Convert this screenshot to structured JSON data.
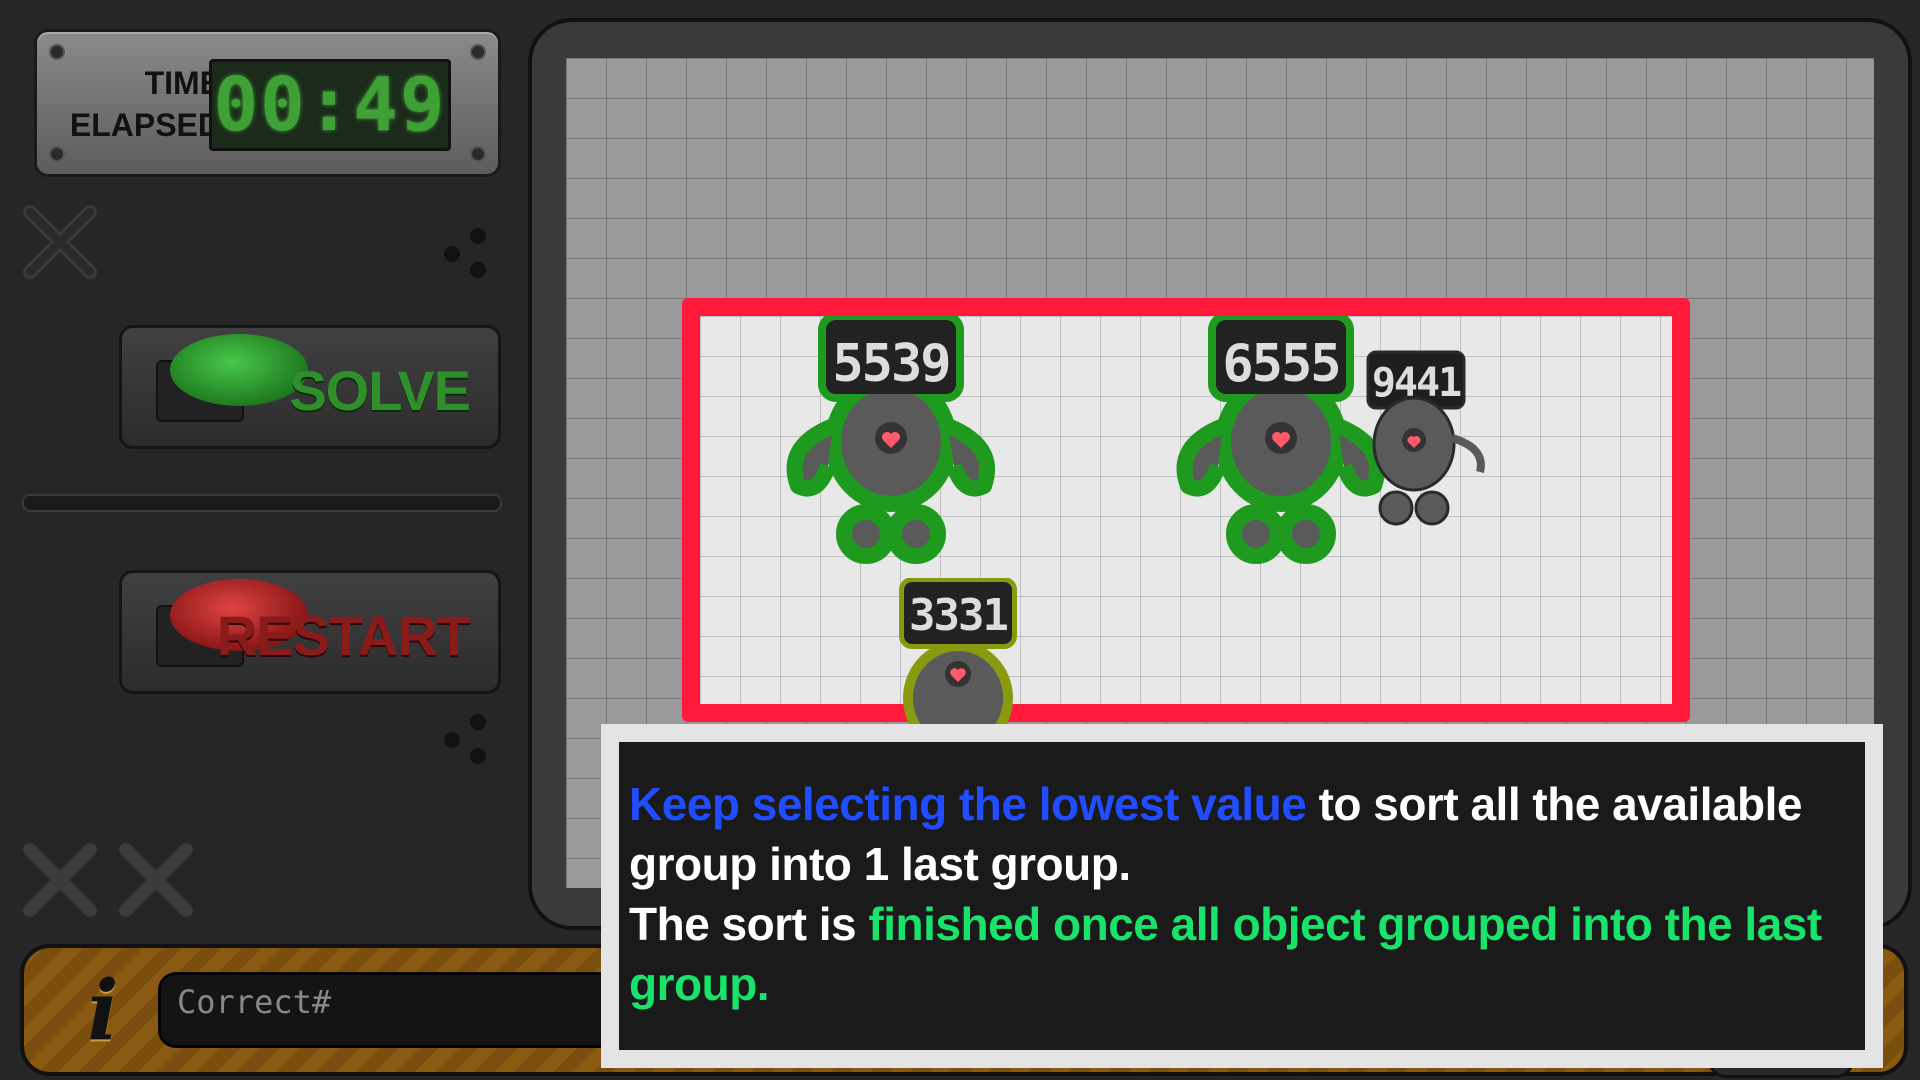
{
  "timer": {
    "label_line1": "TIME",
    "label_line2": "ELAPSED",
    "value": "00:49"
  },
  "buttons": {
    "solve_label": "SOLVE",
    "restart_label": "RESTART"
  },
  "robots": [
    {
      "value": "5539",
      "outline": "green"
    },
    {
      "value": "6555",
      "outline": "green"
    },
    {
      "value": "9441",
      "outline": "none"
    },
    {
      "value": "3331",
      "outline": "yellow"
    }
  ],
  "info_bar": {
    "icon": "info-icon",
    "status_text": "Correct#"
  },
  "tutorial": {
    "part1_highlight": "Keep selecting the lowest value",
    "part1_rest": " to sort all the available group into 1 last group.",
    "part2_lead": "The sort is ",
    "part2_highlight": "finished once all object grouped into the last group."
  },
  "colors": {
    "highlight_box": "#ff1a3c",
    "tutorial_blue": "#1f4dff",
    "tutorial_green": "#19e36b",
    "timer_digits": "#3fa036"
  }
}
